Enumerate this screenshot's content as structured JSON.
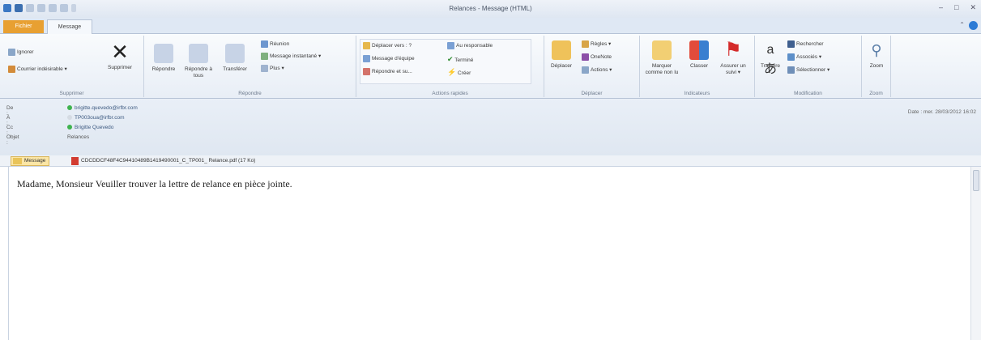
{
  "window": {
    "title": "Relances - Message (HTML)",
    "tab_file": "Fichier",
    "tab_message": "Message"
  },
  "ribbon": {
    "groups": {
      "supprimer": "Supprimer",
      "repondre": "Répondre",
      "actions_rapides": "Actions rapides",
      "deplacer": "Déplacer",
      "indicateurs": "Indicateurs",
      "modification": "Modification",
      "zoom": "Zoom"
    },
    "ignorer": "Ignorer",
    "courrier_indesirable": "Courrier indésirable",
    "supprimer": "Supprimer",
    "repondre": "Répondre",
    "repondre_tous": "Répondre à tous",
    "transferer": "Transférer",
    "reunion": "Réunion",
    "message_instantane": "Message instantané",
    "plus": "Plus",
    "qs_deplacer": "Déplacer vers : ?",
    "qs_message_equipe": "Message d'équipe",
    "qs_repondre_suppr": "Répondre et su...",
    "qs_responsable": "Au responsable",
    "qs_termine": "Terminé",
    "qs_creer": "Créer",
    "deplacer_btn": "Déplacer",
    "regles": "Règles",
    "onenote": "OneNote",
    "actions": "Actions",
    "marquer_non_lu": "Marquer comme non lu",
    "classer": "Classer",
    "assurer_suivi": "Assurer un suivi",
    "traduire": "Traduire",
    "rechercher": "Rechercher",
    "associes": "Associés",
    "selectionner": "Sélectionner",
    "zoom": "Zoom"
  },
  "header": {
    "from_label": "De :",
    "to_label": "À :",
    "cc_label": "Cc :",
    "subject_label": "Objet :",
    "from": "brigitte.quevedo@irfbr.com",
    "to": "TP003oua@irfbr.com",
    "cc": "Brigitte Quevedo",
    "subject": "Relances",
    "date": "Date : mer. 28/03/2012 16:02"
  },
  "attachments": {
    "message_tab": "Message",
    "file": "CDCDDCF48F4C94410489B1419490001_C_TP001_ Relance.pdf (17 Ko)"
  },
  "body": {
    "text": "Madame, Monsieur Veuiller trouver la lettre de relance en pièce jointe."
  },
  "colors": {
    "accent_file_tab": "#e8a032",
    "ribbon_bg": "#e8eef6",
    "presence_online": "#3fb34f"
  }
}
